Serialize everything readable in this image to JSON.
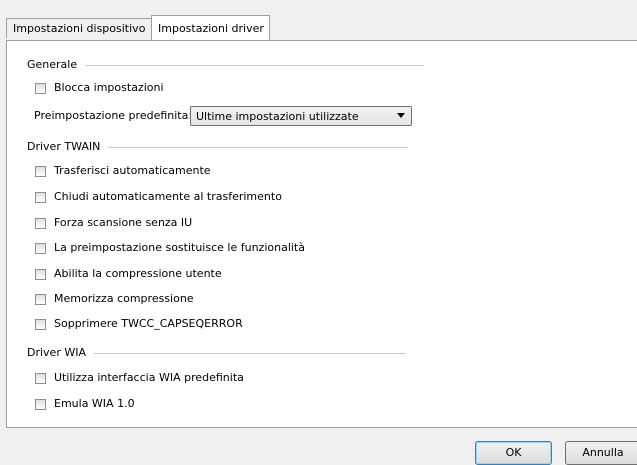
{
  "tabs": [
    {
      "label": "Impostazioni dispositivo",
      "active": false
    },
    {
      "label": "Impostazioni driver",
      "active": true
    }
  ],
  "groups": {
    "general": {
      "title": "Generale",
      "lock_settings": {
        "label": "Blocca impostazioni",
        "checked": false
      },
      "preset_label": "Preimpostazione predefinita:",
      "preset_value": "Ultime impostazioni utilizzate"
    },
    "twain": {
      "title": "Driver TWAIN",
      "items": [
        {
          "label": "Trasferisci automaticamente",
          "checked": false
        },
        {
          "label": "Chiudi automaticamente al trasferimento",
          "checked": false
        },
        {
          "label": "Forza scansione senza IU",
          "checked": false
        },
        {
          "label": "La preimpostazione sostituisce le funzionalità",
          "checked": false
        },
        {
          "label": "Abilita la compressione utente",
          "checked": false
        },
        {
          "label": "Memorizza compressione",
          "checked": false
        },
        {
          "label": "Sopprimere TWCC_CAPSEQERROR",
          "checked": false
        }
      ]
    },
    "wia": {
      "title": "Driver WIA",
      "items": [
        {
          "label": "Utilizza interfaccia WIA predefinita",
          "checked": false
        },
        {
          "label": "Emula WIA 1.0",
          "checked": false
        }
      ]
    }
  },
  "buttons": {
    "ok": "OK",
    "cancel": "Annulla"
  }
}
